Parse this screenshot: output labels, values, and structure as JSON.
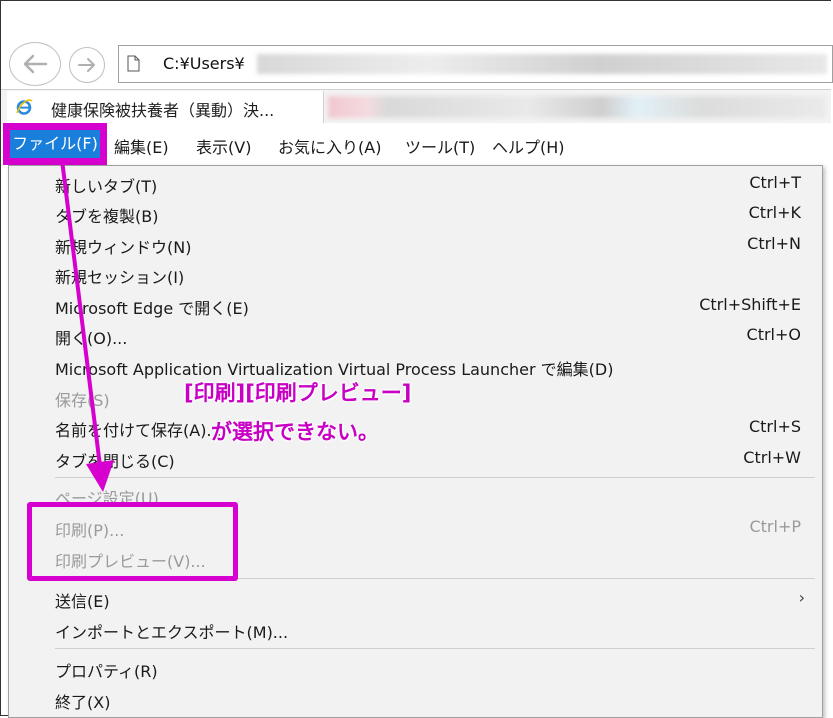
{
  "address_bar": {
    "path_text": "C:¥Users¥"
  },
  "tab": {
    "title": "健康保険被扶養者（異動）決..."
  },
  "menubar": {
    "items": [
      {
        "label": "ファイル(F)",
        "active": true
      },
      {
        "label": "編集(E)"
      },
      {
        "label": "表示(V)"
      },
      {
        "label": "お気に入り(A)"
      },
      {
        "label": "ツール(T)"
      },
      {
        "label": "ヘルプ(H)"
      }
    ]
  },
  "file_menu": {
    "items": [
      {
        "label": "新しいタブ(T)",
        "shortcut": "Ctrl+T",
        "enabled": true
      },
      {
        "label": "タブを複製(B)",
        "shortcut": "Ctrl+K",
        "enabled": true
      },
      {
        "label": "新規ウィンドウ(N)",
        "shortcut": "Ctrl+N",
        "enabled": true
      },
      {
        "label": "新規セッション(I)",
        "shortcut": "",
        "enabled": true
      },
      {
        "label": "Microsoft Edge で開く(E)",
        "shortcut": "Ctrl+Shift+E",
        "enabled": true
      },
      {
        "label": "開く(O)...",
        "shortcut": "Ctrl+O",
        "enabled": true
      },
      {
        "label": "Microsoft Application Virtualization Virtual Process Launcher で編集(D)",
        "shortcut": "",
        "enabled": true
      },
      {
        "label": "保存(S)",
        "shortcut": "",
        "enabled": false
      },
      {
        "label": "名前を付けて保存(A)...",
        "shortcut": "Ctrl+S",
        "enabled": true
      },
      {
        "label": "タブを閉じる(C)",
        "shortcut": "Ctrl+W",
        "enabled": true
      },
      {
        "label": "ページ設定(U)...",
        "shortcut": "",
        "enabled": false
      },
      {
        "label": "印刷(P)...",
        "shortcut": "Ctrl+P",
        "enabled": false
      },
      {
        "label": "印刷プレビュー(V)...",
        "shortcut": "",
        "enabled": false
      },
      {
        "label": "送信(E)",
        "shortcut": "",
        "enabled": true,
        "submenu": true
      },
      {
        "label": "インポートとエクスポート(M)...",
        "shortcut": "",
        "enabled": true
      },
      {
        "label": "プロパティ(R)",
        "shortcut": "",
        "enabled": true
      },
      {
        "label": "終了(X)",
        "shortcut": "",
        "enabled": true
      }
    ]
  },
  "annotation": {
    "line1": "[印刷][印刷プレビュー]",
    "line2": "が選択できない。",
    "color": "#d600cf"
  },
  "colors": {
    "menu_highlight": "#1a7fdb",
    "menu_bg": "#f2f2f2",
    "disabled_text": "#9a9a9a"
  }
}
